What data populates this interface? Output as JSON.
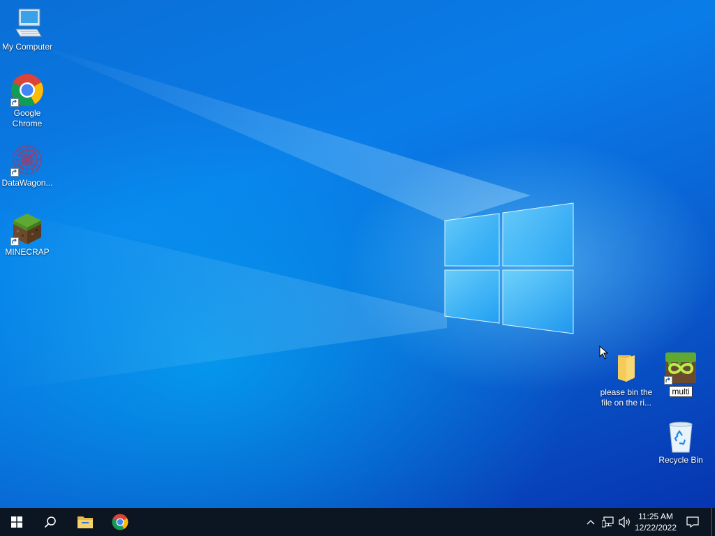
{
  "desktop": {
    "icons": [
      {
        "label": "My Computer",
        "icon": "computer-icon"
      },
      {
        "label": "Google Chrome",
        "icon": "chrome-icon"
      },
      {
        "label": "DataWagon...",
        "icon": "datawagon-icon"
      },
      {
        "label": "MINECRAP",
        "icon": "minecraft-grass-block-icon"
      },
      {
        "label": "please bin the file on the ri...",
        "icon": "folder-icon"
      },
      {
        "label": "multi",
        "icon": "multimc-icon",
        "state": "renaming"
      },
      {
        "label": "Recycle Bin",
        "icon": "recycle-bin-icon"
      }
    ]
  },
  "taskbar": {
    "start": "windows-start-icon",
    "search": "search-icon",
    "pinned": [
      "file-explorer-icon",
      "chrome-icon"
    ],
    "tray": {
      "overflow": "chevron-up-icon",
      "network": "network-icon",
      "volume": "volume-icon",
      "time": "11:25 AM",
      "date": "12/22/2022",
      "notifications": "action-center-icon"
    }
  },
  "colors": {
    "taskbar": "#0b1622",
    "desktop_accent": "#0a78e0"
  }
}
